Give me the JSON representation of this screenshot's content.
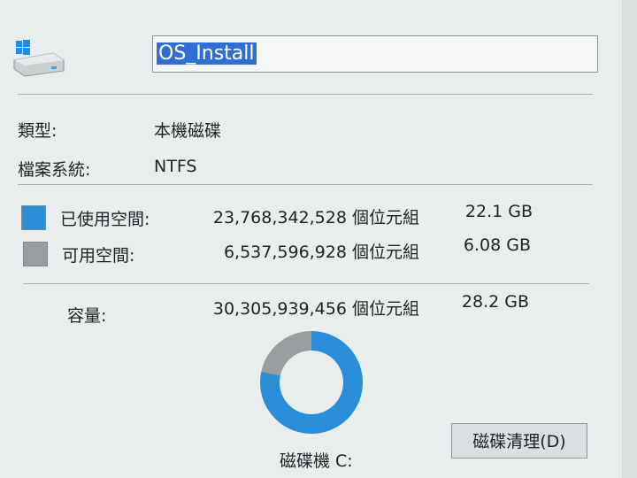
{
  "drive": {
    "name": "OS_Install",
    "icon": "windows-drive-icon"
  },
  "properties": {
    "type_label": "類型:",
    "type_value": "本機磁碟",
    "fs_label": "檔案系統:",
    "fs_value": "NTFS"
  },
  "space": {
    "used_label": "已使用空間:",
    "used_bytes": "23,768,342,528 個位元組",
    "used_size": "22.1 GB",
    "used_color": "#2a8fd8",
    "free_label": "可用空間:",
    "free_bytes": "6,537,596,928 個位元組",
    "free_size": "6.08 GB",
    "free_color": "#9a9d9f",
    "capacity_label": "容量:",
    "capacity_bytes": "30,305,939,456 個位元組",
    "capacity_size": "28.2 GB"
  },
  "chart_data": {
    "type": "pie",
    "categories": [
      "已使用空間",
      "可用空間"
    ],
    "values": [
      22.1,
      6.08
    ],
    "colors": [
      "#2a8fd8",
      "#9a9d9f"
    ]
  },
  "footer": {
    "drive_label": "磁碟機 C:",
    "cleanup_button": "磁碟清理(D)"
  }
}
